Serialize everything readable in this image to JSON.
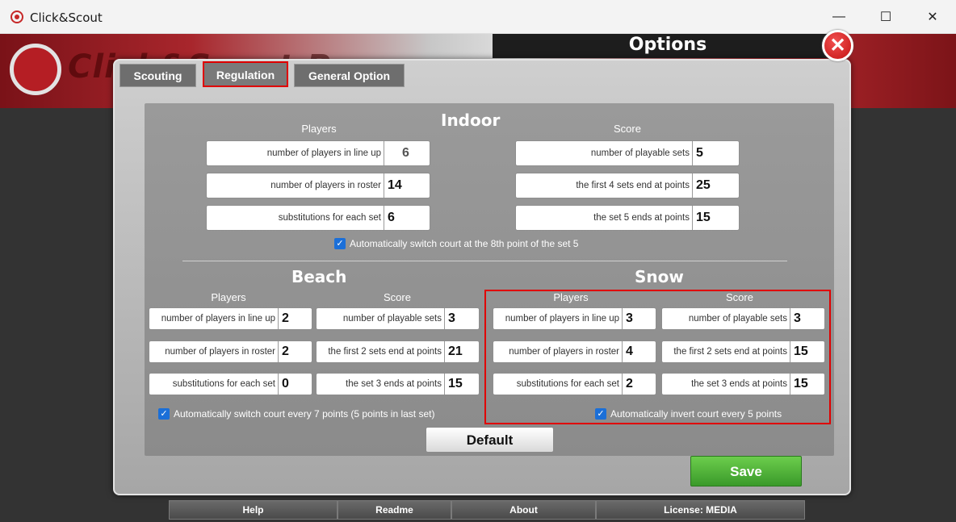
{
  "window": {
    "title": "Click&Scout",
    "min_glyph": "—",
    "max_glyph": "☐",
    "close_glyph": "✕"
  },
  "banner": {
    "logo_text": "Click&Scout Pro"
  },
  "options": {
    "title": "Options",
    "close_glyph": "✕"
  },
  "tabs": [
    {
      "label": "Scouting"
    },
    {
      "label": "Regulation"
    },
    {
      "label": "General Option"
    }
  ],
  "indoor": {
    "title": "Indoor",
    "players_header": "Players",
    "score_header": "Score",
    "players": [
      {
        "label": "number of players in line up",
        "value": "6"
      },
      {
        "label": "number of players in roster",
        "value": "14"
      },
      {
        "label": "substitutions for each set",
        "value": "6"
      }
    ],
    "score": [
      {
        "label": "number of playable sets",
        "value": "5"
      },
      {
        "label": "the first 4 sets end at points",
        "value": "25"
      },
      {
        "label": "the set 5 ends at points",
        "value": "15"
      }
    ],
    "checkbox": "Automatically switch court at the 8th point of the set 5"
  },
  "beach": {
    "title": "Beach",
    "players_header": "Players",
    "score_header": "Score",
    "players": [
      {
        "label": "number of players in line up",
        "value": "2"
      },
      {
        "label": "number of players in roster",
        "value": "2"
      },
      {
        "label": "substitutions for each set",
        "value": "0"
      }
    ],
    "score": [
      {
        "label": "number of playable sets",
        "value": "3"
      },
      {
        "label": "the first 2 sets end at points",
        "value": "21"
      },
      {
        "label": "the set 3 ends at points",
        "value": "15"
      }
    ],
    "checkbox": "Automatically switch court every 7 points (5 points in last set)"
  },
  "snow": {
    "title": "Snow",
    "players_header": "Players",
    "score_header": "Score",
    "players": [
      {
        "label": "number of players in line up",
        "value": "3"
      },
      {
        "label": "number of players in roster",
        "value": "4"
      },
      {
        "label": "substitutions for each set",
        "value": "2"
      }
    ],
    "score": [
      {
        "label": "number of playable sets",
        "value": "3"
      },
      {
        "label": "the first 2 sets end at points",
        "value": "15"
      },
      {
        "label": "the set 3 ends at points",
        "value": "15"
      }
    ],
    "checkbox": "Automatically invert court every 5 points"
  },
  "buttons": {
    "default": "Default",
    "save": "Save"
  },
  "footer": [
    {
      "label": "Help"
    },
    {
      "label": "Readme"
    },
    {
      "label": "About"
    },
    {
      "label": "License: MEDIA"
    }
  ],
  "colors": {
    "accent_red": "#e00000",
    "save_green": "#4caf32",
    "checkbox_blue": "#1b6fd8"
  }
}
